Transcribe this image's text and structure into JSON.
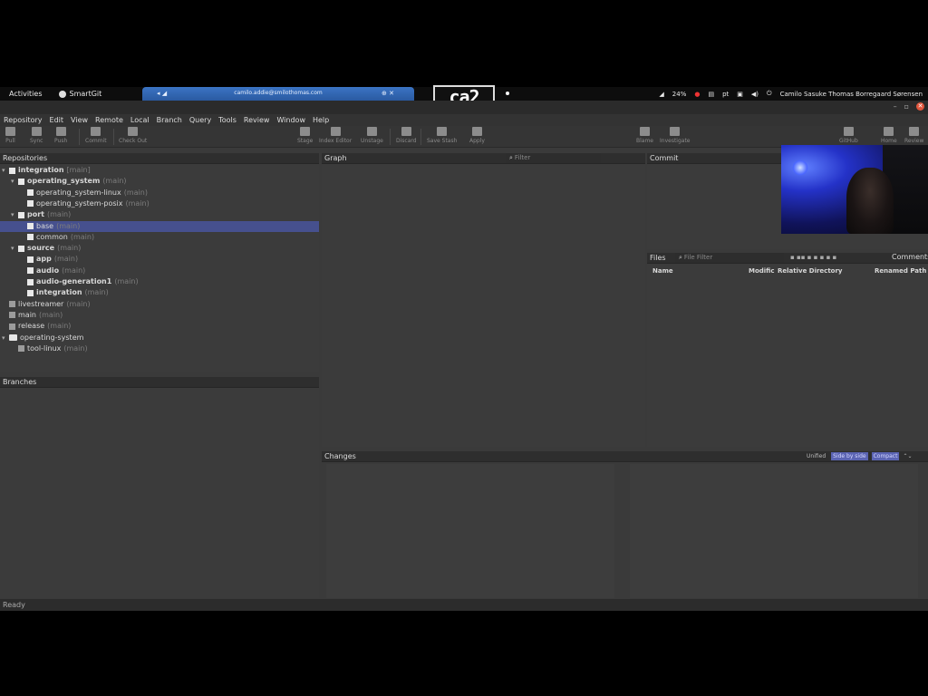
{
  "os": {
    "activities": "Activities",
    "app_name": "SmartGit",
    "browser_tab_url": "camilo.addie@smilothomas.com",
    "logo_text": "ca2",
    "battery": "24%",
    "lang": "pt",
    "user": "Camilo Sasuke Thomas Borregaard Sørensen"
  },
  "menu": [
    "Repository",
    "Edit",
    "View",
    "Remote",
    "Local",
    "Branch",
    "Query",
    "Tools",
    "Review",
    "Window",
    "Help"
  ],
  "toolbar": {
    "pull": "Pull",
    "sync": "Sync",
    "push": "Push",
    "commit": "Commit",
    "checkout": "Check Out",
    "stage": "Stage",
    "index_editor": "Index Editor",
    "unstage": "Unstage",
    "discard": "Discard",
    "save_stash": "Save Stash",
    "apply": "Apply",
    "blame": "Blame",
    "investigate": "Investigate",
    "github": "GitHub",
    "home": "Home",
    "review": "Review"
  },
  "repositories": {
    "header": "Repositories",
    "items": [
      {
        "name": "integration",
        "branch": "[main]",
        "level": 0,
        "expander": "▾",
        "icon": "box",
        "bold": true
      },
      {
        "name": "operating_system",
        "branch": "(main)",
        "level": 1,
        "expander": "▾",
        "icon": "box",
        "bold": true
      },
      {
        "name": "operating_system-linux",
        "branch": "(main)",
        "level": 2,
        "expander": "",
        "icon": "box",
        "bold": false
      },
      {
        "name": "operating_system-posix",
        "branch": "(main)",
        "level": 2,
        "expander": "",
        "icon": "box",
        "bold": false
      },
      {
        "name": "port",
        "branch": "(main)",
        "level": 1,
        "expander": "▾",
        "icon": "box",
        "bold": true
      },
      {
        "name": "base",
        "branch": "(main)",
        "level": 2,
        "expander": "",
        "icon": "box",
        "bold": false,
        "selected": true
      },
      {
        "name": "common",
        "branch": "(main)",
        "level": 2,
        "expander": "",
        "icon": "box",
        "bold": false
      },
      {
        "name": "source",
        "branch": "(main)",
        "level": 1,
        "expander": "▾",
        "icon": "box",
        "bold": true
      },
      {
        "name": "app",
        "branch": "(main)",
        "level": 2,
        "expander": "",
        "icon": "box",
        "bold": true
      },
      {
        "name": "audio",
        "branch": "(main)",
        "level": 2,
        "expander": "",
        "icon": "box",
        "bold": true
      },
      {
        "name": "audio-generation1",
        "branch": "(main)",
        "level": 2,
        "expander": "",
        "icon": "box",
        "bold": true
      },
      {
        "name": "integration",
        "branch": "(main)",
        "level": 2,
        "expander": "",
        "icon": "box",
        "bold": true
      },
      {
        "name": "livestreamer",
        "branch": "(main)",
        "level": 0,
        "expander": "",
        "icon": "grey",
        "bold": false
      },
      {
        "name": "main",
        "branch": "(main)",
        "level": 0,
        "expander": "",
        "icon": "grey",
        "bold": false
      },
      {
        "name": "release",
        "branch": "(main)",
        "level": 0,
        "expander": "",
        "icon": "grey",
        "bold": false
      },
      {
        "name": "operating-system",
        "branch": "",
        "level": 0,
        "expander": "▾",
        "icon": "folder",
        "bold": false
      },
      {
        "name": "tool-linux",
        "branch": "(main)",
        "level": 1,
        "expander": "",
        "icon": "grey",
        "bold": false
      }
    ]
  },
  "branches": {
    "header": "Branches"
  },
  "graph": {
    "header": "Graph",
    "filter_placeholder": "Filter"
  },
  "commit": {
    "header": "Commit"
  },
  "files": {
    "header": "Files",
    "filter_placeholder": "File Filter",
    "comments_label": "Comments",
    "columns": [
      "Name",
      "Modific",
      "Relative Directory",
      "Renamed Path"
    ]
  },
  "changes": {
    "header": "Changes",
    "mode_unified": "Unified",
    "mode_side_by_side": "Side by side",
    "compact": "Compact"
  },
  "status": "Ready"
}
